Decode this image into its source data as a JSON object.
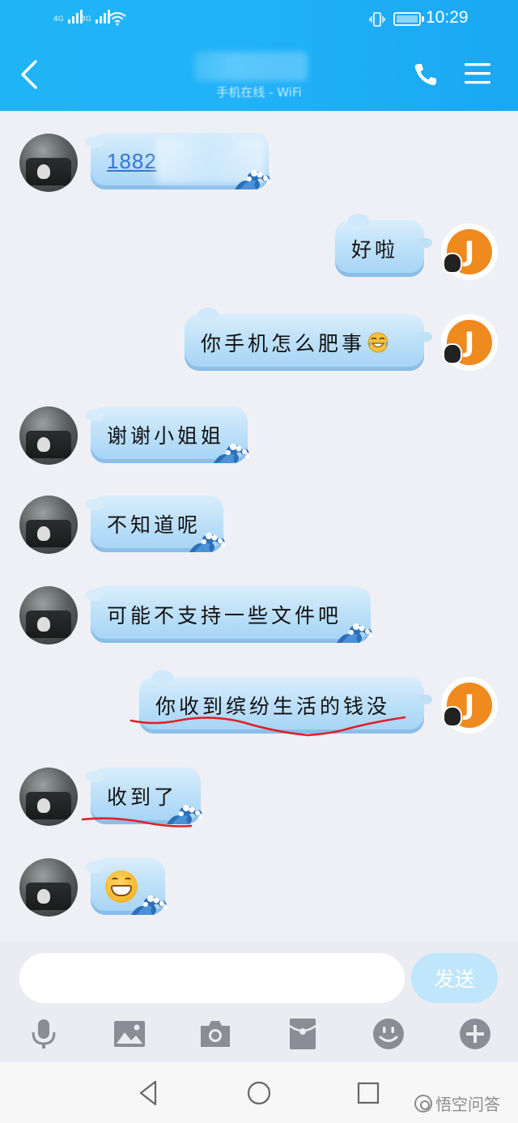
{
  "status_bar": {
    "sim1": "4G",
    "sim2": "3G",
    "time": "10:29"
  },
  "header": {
    "contact_name": "",
    "subtitle": "手机在线 - WiFi"
  },
  "messages": [
    {
      "side": "left",
      "type": "phone_number",
      "text": "1882"
    },
    {
      "side": "right",
      "type": "text",
      "text": "好啦"
    },
    {
      "side": "right",
      "type": "text",
      "text": "你手机怎么肥事",
      "emoji": "laughing-tears-emoji"
    },
    {
      "side": "left",
      "type": "text",
      "text": "谢谢小姐姐"
    },
    {
      "side": "left",
      "type": "text",
      "text": "不知道呢"
    },
    {
      "side": "left",
      "type": "text",
      "text": "可能不支持一些文件吧"
    },
    {
      "side": "right",
      "type": "text",
      "text": "你收到缤纷生活的钱没",
      "annotation": "red-underline"
    },
    {
      "side": "left",
      "type": "text",
      "text": "收到了",
      "annotation": "red-underline"
    },
    {
      "side": "left",
      "type": "emoji",
      "emoji": "grinning-face-emoji"
    }
  ],
  "my_avatar_letter": "J",
  "input": {
    "placeholder": "",
    "send_label": "发送"
  },
  "toolbar": [
    "microphone-icon",
    "image-icon",
    "camera-icon",
    "red-packet-icon",
    "emoji-icon",
    "plus-icon"
  ],
  "watermark": "悟空问答",
  "colors": {
    "header": "#1fb4f6",
    "bubble": "#b9def8",
    "link": "#3576c8",
    "avatar_orange": "#ef8a1e",
    "send_button": "#bfe6fa",
    "annotation_red": "#e0202a"
  }
}
